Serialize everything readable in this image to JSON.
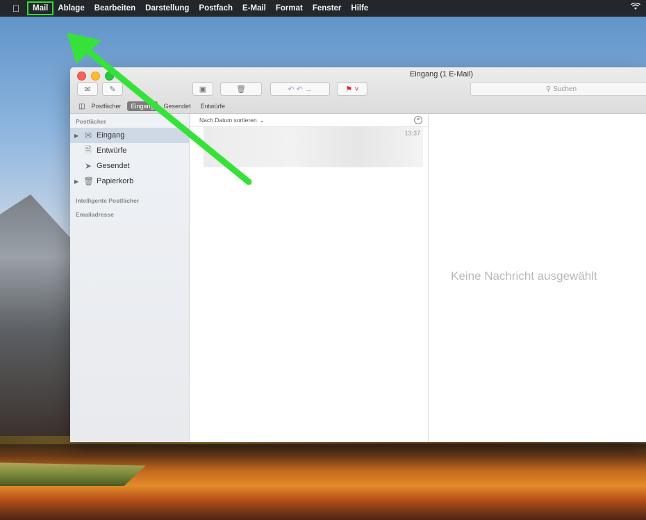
{
  "menubar": {
    "apple": "",
    "items": [
      "Mail",
      "Ablage",
      "Bearbeiten",
      "Darstellung",
      "Postfach",
      "E-Mail",
      "Format",
      "Fenster",
      "Hilfe"
    ]
  },
  "window": {
    "title": "Eingang (1 E-Mail)",
    "search_placeholder": "Suchen",
    "favorites": [
      "Postfächer",
      "Eingang",
      "Gesendet",
      "Entwürfe"
    ]
  },
  "sidebar": {
    "header": "Postfächer",
    "items": [
      {
        "label": "Eingang",
        "icon": "inbox-icon",
        "selected": true,
        "expandable": true
      },
      {
        "label": "Entwürfe",
        "icon": "draft-icon",
        "selected": false,
        "expandable": false
      },
      {
        "label": "Gesendet",
        "icon": "sent-icon",
        "selected": false,
        "expandable": false
      },
      {
        "label": "Papierkorb",
        "icon": "trash-icon",
        "selected": false,
        "expandable": true
      }
    ],
    "section_smart": "Intelligente Postfächer",
    "section_email": "Emailadresse"
  },
  "list": {
    "sort_label": "Nach Datum sortieren",
    "message_time": "13:37"
  },
  "detail": {
    "empty_text": "Keine Nachricht ausgewählt"
  },
  "colors": {
    "highlight": "#2fdc2f",
    "selection": "#cfd9e6"
  }
}
